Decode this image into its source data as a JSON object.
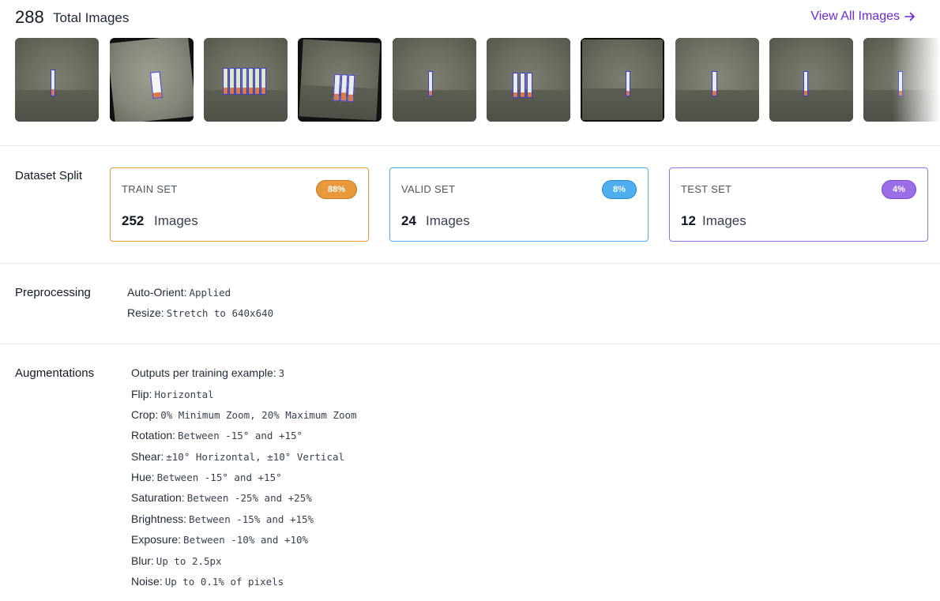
{
  "header": {
    "total_count": "288",
    "total_label": "Total Images",
    "view_all_label": "View All Images"
  },
  "thumbnails": [
    {
      "name": "thumbnail-1"
    },
    {
      "name": "thumbnail-2"
    },
    {
      "name": "thumbnail-3"
    },
    {
      "name": "thumbnail-4"
    },
    {
      "name": "thumbnail-5"
    },
    {
      "name": "thumbnail-6"
    },
    {
      "name": "thumbnail-7"
    },
    {
      "name": "thumbnail-8"
    },
    {
      "name": "thumbnail-9"
    },
    {
      "name": "thumbnail-10"
    }
  ],
  "dataset_split": {
    "title": "Dataset Split",
    "train": {
      "label": "TRAIN SET",
      "percent": "88%",
      "count": "252",
      "unit": "Images",
      "color": "#e8993c"
    },
    "valid": {
      "label": "VALID SET",
      "percent": "8%",
      "count": "24",
      "unit": "Images",
      "color": "#4eaef0"
    },
    "test": {
      "label": "TEST SET",
      "percent": "4%",
      "count": "12",
      "unit": "Images",
      "color": "#9b6ee8"
    }
  },
  "preprocessing": {
    "title": "Preprocessing",
    "items": [
      {
        "key": "Auto-Orient:",
        "value": "Applied"
      },
      {
        "key": "Resize:",
        "value": "Stretch to 640x640"
      }
    ]
  },
  "augmentations": {
    "title": "Augmentations",
    "items": [
      {
        "key": "Outputs per training example:",
        "value": "3"
      },
      {
        "key": "Flip:",
        "value": "Horizontal"
      },
      {
        "key": "Crop:",
        "value": "0% Minimum Zoom, 20% Maximum Zoom"
      },
      {
        "key": "Rotation:",
        "value": "Between -15° and +15°"
      },
      {
        "key": "Shear:",
        "value": "±10° Horizontal, ±10° Vertical"
      },
      {
        "key": "Hue:",
        "value": "Between -15° and +15°"
      },
      {
        "key": "Saturation:",
        "value": "Between -25% and +25%"
      },
      {
        "key": "Brightness:",
        "value": "Between -15% and +15%"
      },
      {
        "key": "Exposure:",
        "value": "Between -10% and +10%"
      },
      {
        "key": "Blur:",
        "value": "Up to 2.5px"
      },
      {
        "key": "Noise:",
        "value": "Up to 0.1% of pixels"
      }
    ]
  }
}
